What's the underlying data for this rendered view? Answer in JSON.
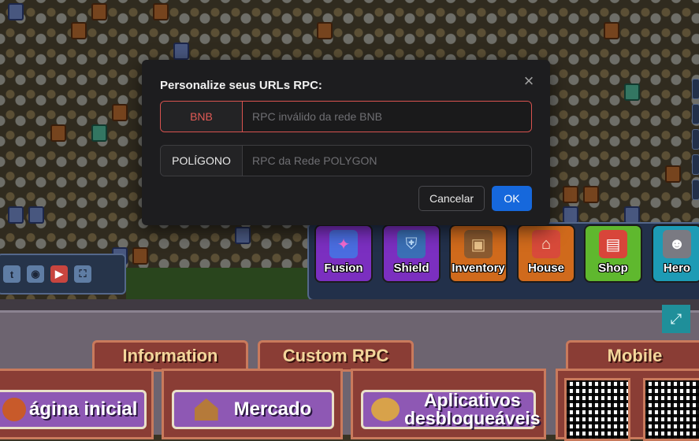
{
  "modal": {
    "title": "Personalize seus URLs RPC:",
    "close_icon": "close-icon",
    "bnb": {
      "label": "BNB",
      "placeholder": "RPC inválido da rede BNB",
      "value": "",
      "state": "error"
    },
    "polygon": {
      "label": "POLÍGONO",
      "placeholder": "RPC da Rede POLYGON",
      "value": ""
    },
    "cancel_label": "Cancelar",
    "ok_label": "OK",
    "colors": {
      "primary": "#1668dc",
      "error": "#d9534f",
      "bg": "#1d1d1f"
    }
  },
  "social": {
    "icons": [
      "twitter-icon",
      "discord-icon",
      "youtube-icon",
      "fullscreen-icon"
    ],
    "glyphs": [
      "t",
      "◉",
      "▶",
      "⛶"
    ]
  },
  "menu": {
    "items": [
      {
        "label": "Fusion",
        "icon": "fusion-icon",
        "glyph": "✦"
      },
      {
        "label": "Shield",
        "icon": "shield-icon",
        "glyph": "⛨"
      },
      {
        "label": "Inventory",
        "icon": "chest-icon",
        "glyph": "▣"
      },
      {
        "label": "House",
        "icon": "house-icon",
        "glyph": "⌂"
      },
      {
        "label": "Shop",
        "icon": "shop-icon",
        "glyph": "▤"
      },
      {
        "label": "Hero",
        "icon": "hero-icon",
        "glyph": "☻"
      }
    ]
  },
  "lower": {
    "expand_icon": "expand-icon",
    "tabs": [
      "Information",
      "Custom RPC",
      "Mobile"
    ],
    "buttons": [
      "ágina inicial",
      "Mercado",
      "Aplicativos desbloqueáveis"
    ]
  }
}
